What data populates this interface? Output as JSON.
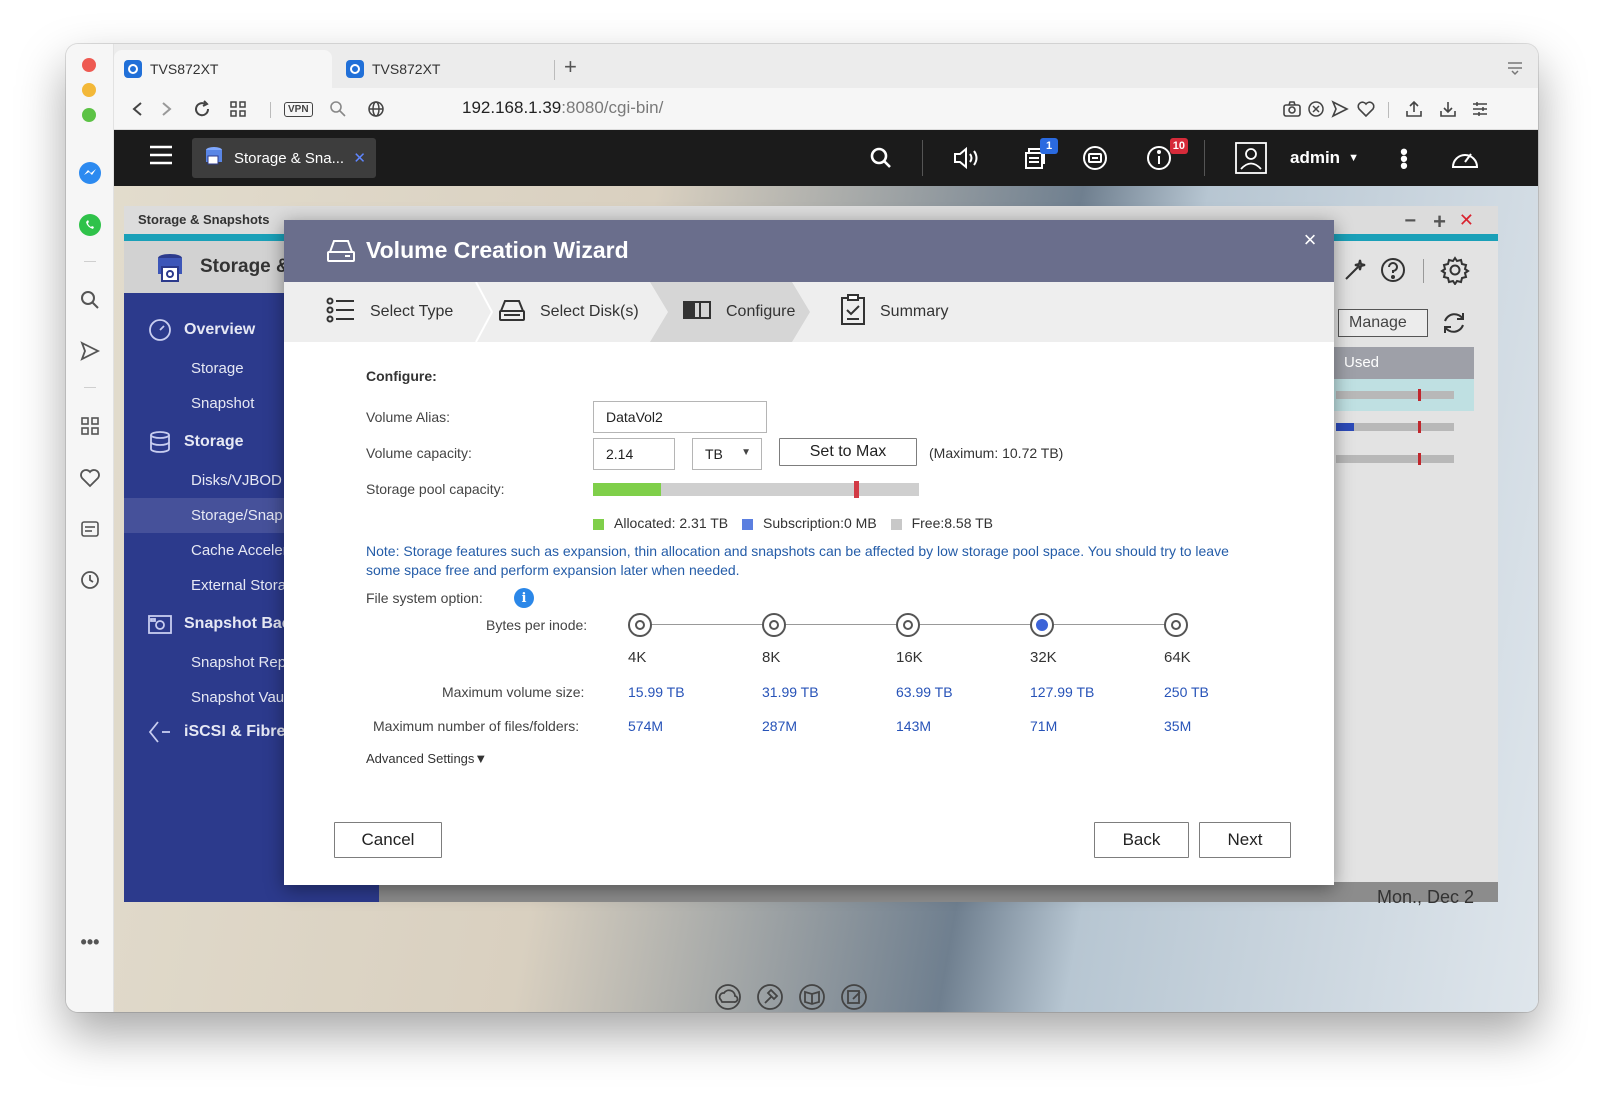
{
  "browser": {
    "tabs": [
      {
        "label": "TVS872XT"
      },
      {
        "label": "TVS872XT"
      }
    ],
    "url_host": "192.168.1.39",
    "url_rest": ":8080/cgi-bin/",
    "vpn_label": "VPN"
  },
  "qts": {
    "app_button_label": "Storage & Sna...",
    "user_label": "admin",
    "notifications": {
      "tasks_badge": "1",
      "info_badge": "10"
    },
    "app_window": {
      "title": "Storage & Snapshots",
      "header": "Storage &",
      "manage_label": "Manage",
      "used_col_label": "Used",
      "date_text": "Mon., Dec 2",
      "nav": [
        {
          "label": "Overview",
          "level": "main",
          "icon": "gauge-icon"
        },
        {
          "label": "Storage",
          "level": "sub"
        },
        {
          "label": "Snapshot",
          "level": "sub"
        },
        {
          "label": "Storage",
          "level": "main",
          "icon": "database-icon"
        },
        {
          "label": "Disks/VJBOD",
          "level": "sub"
        },
        {
          "label": "Storage/Snap",
          "level": "sub",
          "selected": true
        },
        {
          "label": "Cache Acceler",
          "level": "sub"
        },
        {
          "label": "External Stora",
          "level": "sub"
        },
        {
          "label": "Snapshot Bac",
          "level": "main",
          "icon": "camera-icon"
        },
        {
          "label": "Snapshot Rep",
          "level": "sub"
        },
        {
          "label": "Snapshot Vau",
          "level": "sub"
        },
        {
          "label": "iSCSI & Fibre (",
          "level": "main",
          "icon": "iscsi-icon"
        }
      ]
    }
  },
  "wizard": {
    "title": "Volume Creation Wizard",
    "steps": [
      {
        "label": "Select Type",
        "icon": "list-icon"
      },
      {
        "label": "Select Disk(s)",
        "icon": "disk-icon"
      },
      {
        "label": "Configure",
        "icon": "configure-icon",
        "active": true
      },
      {
        "label": "Summary",
        "icon": "clipboard-icon"
      }
    ],
    "section_title": "Configure:",
    "alias_label": "Volume Alias:",
    "alias_value": "DataVol2",
    "capacity_label": "Volume capacity:",
    "capacity_value": "2.14",
    "capacity_unit": "TB",
    "set_max_label": "Set to Max",
    "max_text": "(Maximum: 10.72 TB)",
    "pool_label": "Storage pool capacity:",
    "pool_bar": {
      "allocated_fraction": 0.21,
      "marker_fraction": 0.8
    },
    "legend": [
      {
        "label": "Allocated:",
        "value": "2.31 TB",
        "color": "#7fcf4a"
      },
      {
        "label": "Subscription:",
        "value": "0 MB",
        "color": "#5b7fe0"
      },
      {
        "label": "Free:",
        "value": "8.58 TB",
        "color": "#c8c8c8"
      }
    ],
    "note": "Note: Storage features such as expansion, thin allocation and snapshots can be affected by low storage pool space. You should try to leave some space free and perform expansion later when needed.",
    "fs_label": "File system option:",
    "bpi_label": "Bytes per inode:",
    "max_vol_label": "Maximum volume size:",
    "max_files_label": "Maximum number of files/folders:",
    "inode_options": [
      {
        "label": "4K",
        "max_size": "15.99 TB",
        "max_files": "574M",
        "selected": false
      },
      {
        "label": "8K",
        "max_size": "31.99 TB",
        "max_files": "287M",
        "selected": false
      },
      {
        "label": "16K",
        "max_size": "63.99 TB",
        "max_files": "143M",
        "selected": false
      },
      {
        "label": "32K",
        "max_size": "127.99 TB",
        "max_files": "71M",
        "selected": true
      },
      {
        "label": "64K",
        "max_size": "250 TB",
        "max_files": "35M",
        "selected": false
      }
    ],
    "advanced_label": "Advanced Settings",
    "cancel_label": "Cancel",
    "back_label": "Back",
    "next_label": "Next"
  }
}
